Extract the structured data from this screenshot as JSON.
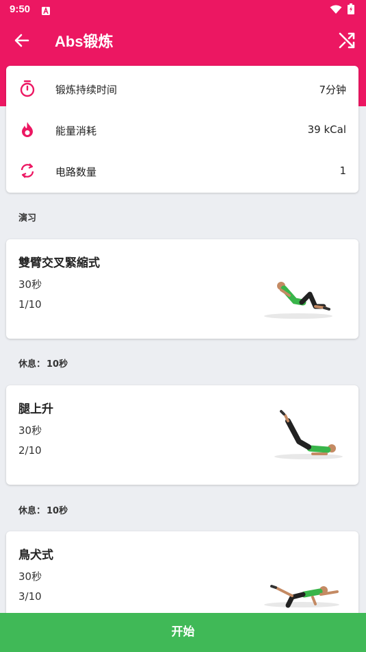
{
  "status_bar": {
    "time": "9:50"
  },
  "toolbar": {
    "title": "Abs锻炼",
    "back_icon": "arrow-back-icon",
    "shuffle_icon": "shuffle-icon"
  },
  "summary": {
    "rows": [
      {
        "icon": "stopwatch-icon",
        "label": "锻炼持续时间",
        "value": "7分钟"
      },
      {
        "icon": "flame-icon",
        "label": "能量消耗",
        "value": "39 kCal"
      },
      {
        "icon": "repeat-icon",
        "label": "电路数量",
        "value": "1"
      }
    ]
  },
  "exercises_section": {
    "label": "演习"
  },
  "exercises": [
    {
      "name": "雙臂交叉緊縮式",
      "duration": "30秒",
      "index": "1/10"
    },
    {
      "name": "腿上升",
      "duration": "30秒",
      "index": "2/10"
    },
    {
      "name": "鳥犬式",
      "duration": "30秒",
      "index": "3/10"
    }
  ],
  "rests": [
    {
      "label": "休息：",
      "value": "10秒"
    },
    {
      "label": "休息：",
      "value": "10秒"
    }
  ],
  "start_button": {
    "label": "开始"
  },
  "colors": {
    "primary": "#ec1762",
    "start_green": "#40b957",
    "background": "#eceef2"
  }
}
